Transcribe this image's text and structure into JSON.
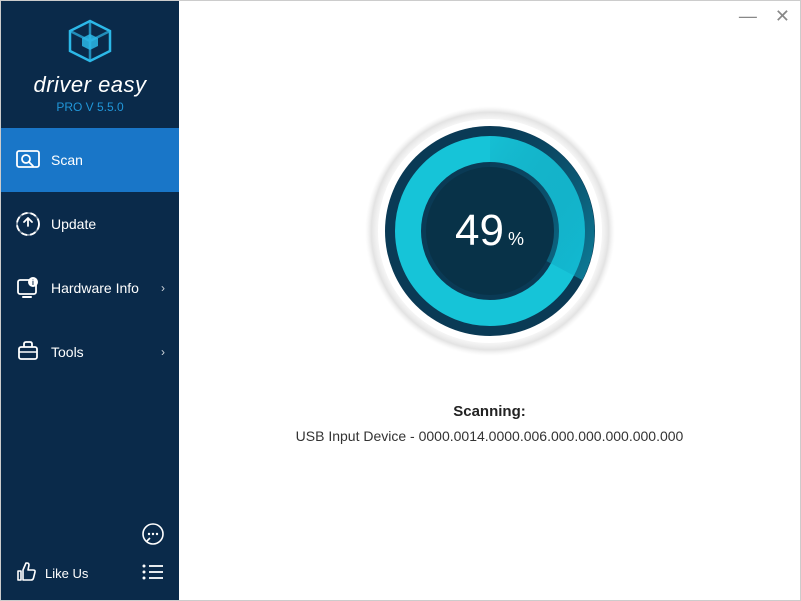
{
  "brand": {
    "name": "driver easy",
    "version": "PRO V 5.5.0"
  },
  "sidebar": {
    "items": [
      {
        "label": "Scan",
        "hasSubmenu": false
      },
      {
        "label": "Update",
        "hasSubmenu": false
      },
      {
        "label": "Hardware Info",
        "hasSubmenu": true
      },
      {
        "label": "Tools",
        "hasSubmenu": true
      }
    ],
    "bottom": {
      "likeLabel": "Like Us"
    }
  },
  "scan": {
    "progress": 49,
    "unit": "%",
    "statusLabel": "Scanning:",
    "detail": "USB Input Device - 0000.0014.0000.006.000.000.000.000.000"
  },
  "colors": {
    "sidebarBg": "#0a2a4a",
    "accent": "#1976c8",
    "cyan": "#16c4d8",
    "darkTeal": "#0a4a6a"
  }
}
